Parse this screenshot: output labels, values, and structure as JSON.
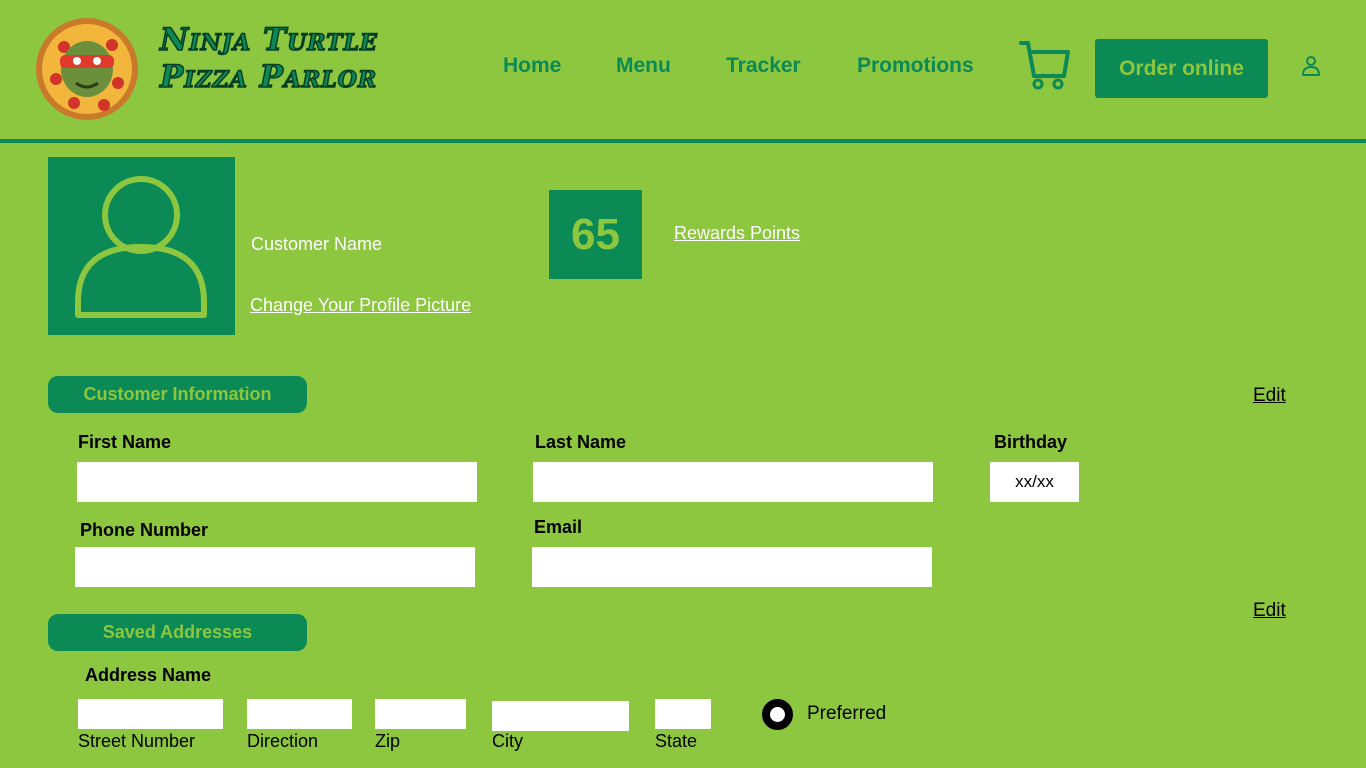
{
  "header": {
    "logo_line1": "Ninja Turtle",
    "logo_line2": "Pizza Parlor",
    "nav": [
      {
        "label": "Home"
      },
      {
        "label": "Menu"
      },
      {
        "label": "Tracker"
      },
      {
        "label": "Promotions"
      }
    ],
    "order_button": "Order online"
  },
  "profile": {
    "customer_name": "Customer Name",
    "change_picture": "Change Your Profile Picture",
    "points": "65",
    "rewards_label": "Rewards Points"
  },
  "customer_info": {
    "title": "Customer Information",
    "edit": "Edit",
    "first_name_label": "First Name",
    "first_name_value": "",
    "last_name_label": "Last Name",
    "last_name_value": "",
    "birthday_label": "Birthday",
    "birthday_value": "xx/xx",
    "phone_label": "Phone Number",
    "phone_value": "",
    "email_label": "Email",
    "email_value": ""
  },
  "addresses": {
    "title": "Saved Addresses",
    "edit": "Edit",
    "address_name_label": "Address Name",
    "street_number_label": "Street Number",
    "direction_label": "Direction",
    "zip_label": "Zip",
    "city_label": "City",
    "state_label": "State",
    "preferred_label": "Preferred",
    "preferred_selected": true
  },
  "colors": {
    "background": "#8dc63f",
    "accent": "#0b8a55"
  }
}
